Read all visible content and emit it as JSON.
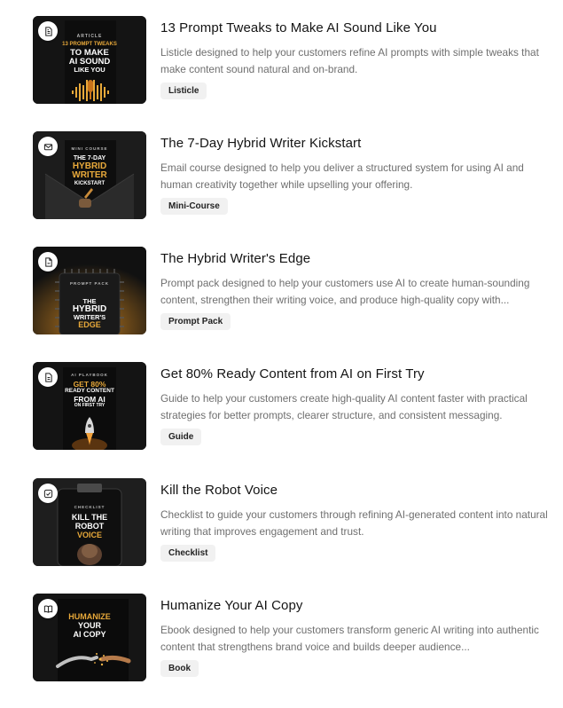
{
  "items": [
    {
      "title": "13 Prompt Tweaks to Make AI Sound Like You",
      "description": "Listicle designed to help your customers refine AI prompts with simple tweaks that make content sound natural and on-brand.",
      "badge": "Listicle",
      "icon": "document-list-icon",
      "cover": {
        "kicker": "ARTICLE",
        "line1": "13 PROMPT TWEAKS",
        "line2": "TO MAKE",
        "line3": "AI SOUND",
        "line4": "LIKE YOU"
      }
    },
    {
      "title": "The 7-Day Hybrid Writer Kickstart",
      "description": "Email course designed to help you deliver a structured system for using AI and human creativity together while upselling your offering.",
      "badge": "Mini-Course",
      "icon": "mail-icon",
      "cover": {
        "kicker": "MINI COURSE",
        "line1": "THE 7-DAY",
        "line2": "HYBRID",
        "line3": "WRITER",
        "line4": "KICKSTART"
      }
    },
    {
      "title": "The Hybrid Writer's Edge",
      "description": "Prompt pack designed to help your customers use AI to create human-sounding content, strengthen their writing voice, and produce high-quality copy with...",
      "badge": "Prompt Pack",
      "icon": "file-icon",
      "cover": {
        "kicker": "PROMPT PACK",
        "line1": "THE",
        "line2": "HYBRID",
        "line3": "WRITER'S",
        "line4": "EDGE"
      }
    },
    {
      "title": "Get 80% Ready Content from AI on First Try",
      "description": "Guide to help your customers create high-quality AI content faster with practical strategies for better prompts, clearer structure, and consistent messaging.",
      "badge": "Guide",
      "icon": "file-text-icon",
      "cover": {
        "kicker": "AI PLAYBOOK",
        "line1": "GET 80%",
        "line2": "READY CONTENT",
        "line3": "FROM AI",
        "line4": "ON FIRST TRY"
      }
    },
    {
      "title": "Kill the Robot Voice",
      "description": "Checklist to guide your customers through refining AI-generated content into natural writing that improves engagement and trust.",
      "badge": "Checklist",
      "icon": "checkbox-icon",
      "cover": {
        "kicker": "CHECKLIST",
        "line1": "KILL THE",
        "line2": "ROBOT",
        "line3": "VOICE",
        "line4": ""
      }
    },
    {
      "title": "Humanize Your AI Copy",
      "description": "Ebook designed to help your customers transform generic AI writing into authentic content that strengthens brand voice and builds deeper audience...",
      "badge": "Book",
      "icon": "book-icon",
      "cover": {
        "kicker": "",
        "line1": "HUMANIZE",
        "line2": "YOUR",
        "line3": "AI COPY",
        "line4": ""
      }
    }
  ],
  "colors": {
    "accent_gold": "#e8a93a",
    "cover_bg": "#151515",
    "badge_bg": "#f1f1f1"
  }
}
